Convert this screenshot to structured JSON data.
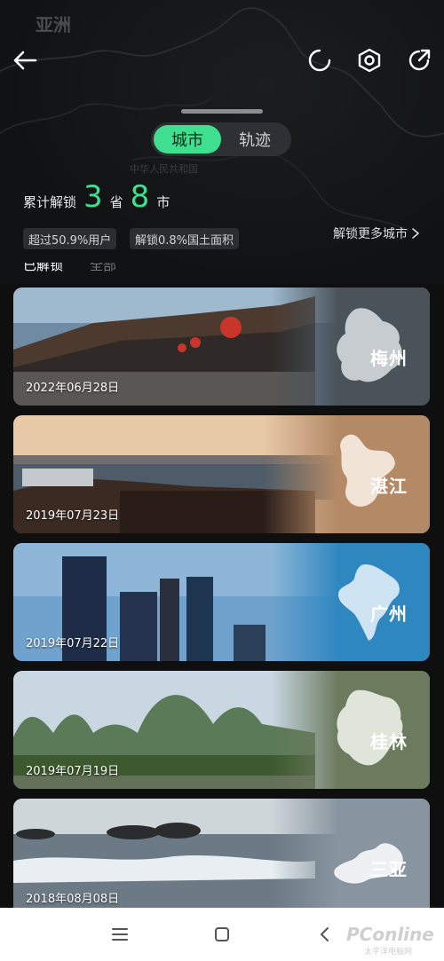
{
  "map": {
    "region_label": "亚洲",
    "country_label": "中华人民共和国"
  },
  "header": {
    "back_icon": "arrow-left-icon",
    "refresh_icon": "refresh-icon",
    "settings_icon": "hexagon-settings-icon",
    "share_icon": "share-icon"
  },
  "segmented": {
    "tabs": [
      "城市",
      "轨迹"
    ],
    "active_index": 0
  },
  "stats": {
    "prefix": "累计解锁",
    "provinces": "3",
    "province_unit": "省",
    "cities": "8",
    "city_unit": "市"
  },
  "chips": [
    "超过50.9%用户",
    "解锁0.8%国土面积"
  ],
  "more_link": "解锁更多城市",
  "subtabs": [
    "已解锁",
    "全部"
  ],
  "cards": [
    {
      "city": "梅州",
      "date": "2022年06月28日",
      "overlay": "#4a535a"
    },
    {
      "city": "湛江",
      "date": "2019年07月23日",
      "overlay": "#b48a66"
    },
    {
      "city": "广州",
      "date": "2019年07月22日",
      "overlay": "#2f87c0"
    },
    {
      "city": "桂林",
      "date": "2019年07月19日",
      "overlay": "#6c7a5e"
    },
    {
      "city": "三亚",
      "date": "2018年08月08日",
      "overlay": "#8895a0"
    }
  ],
  "navbar": {
    "menu_icon": "menu-icon",
    "home_icon": "square-home-icon",
    "back_icon": "chevron-left-icon"
  },
  "watermark": {
    "main": "PConline",
    "sub": "太平洋电脑网"
  },
  "colors": {
    "accent": "#3ee08f",
    "background": "#0f0f10"
  }
}
